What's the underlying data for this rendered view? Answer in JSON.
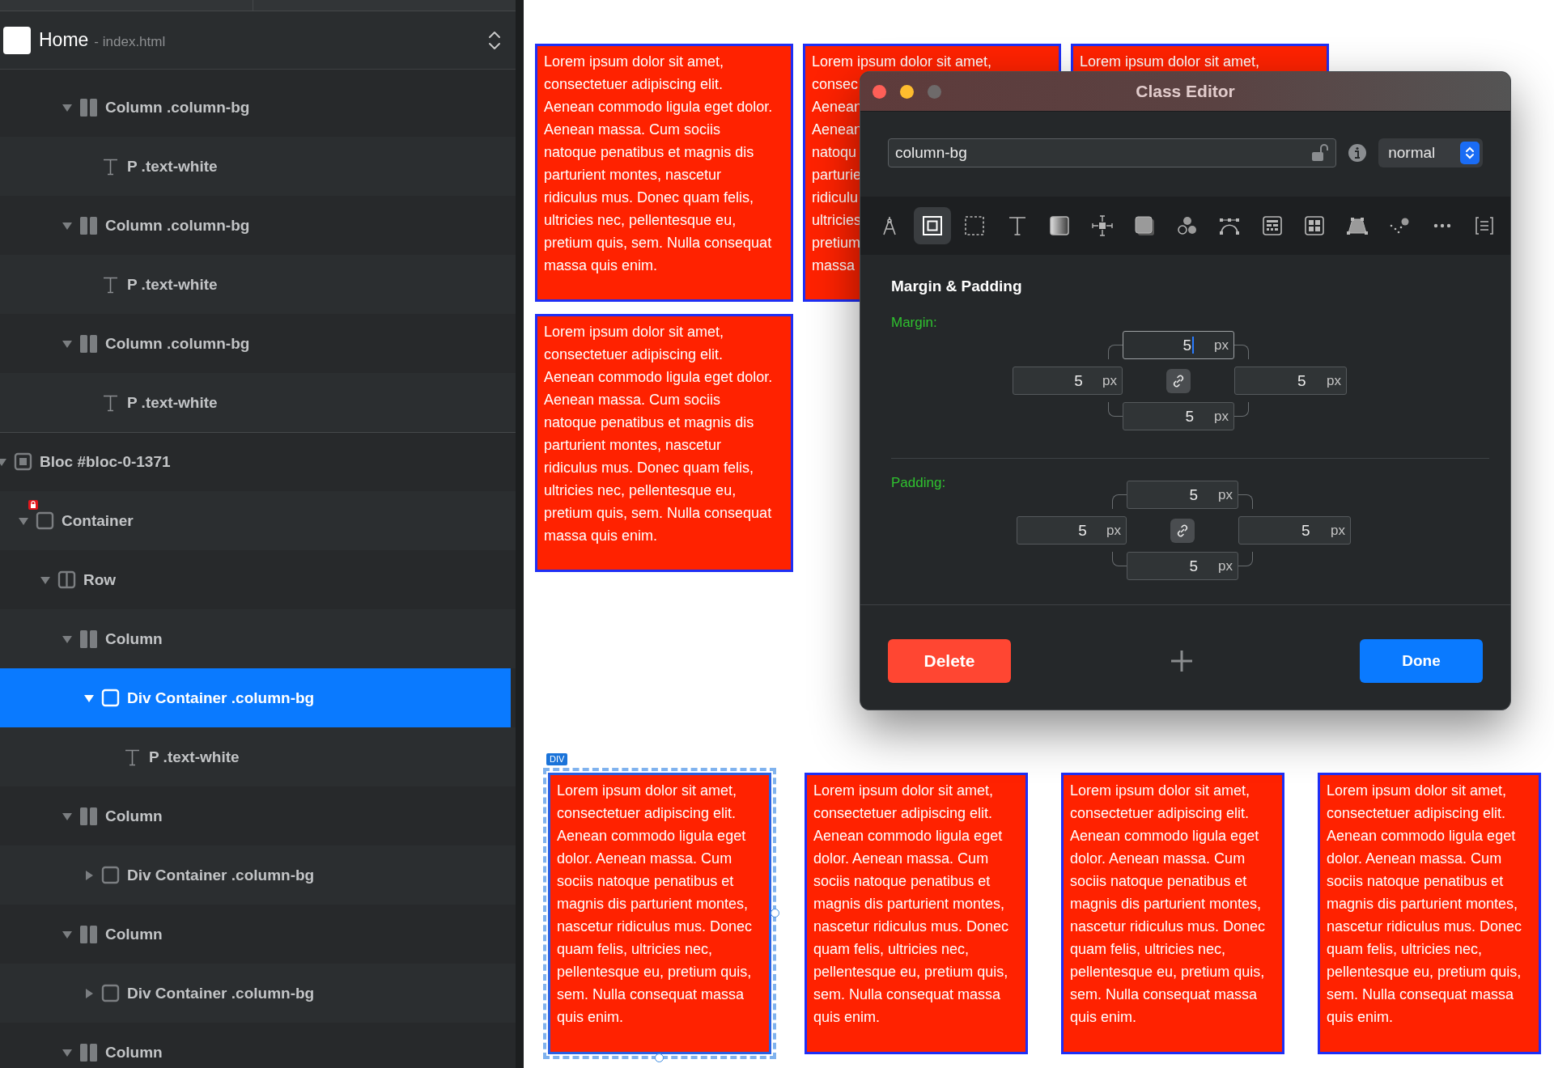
{
  "sidebar": {
    "header": {
      "title": "Home",
      "subtitle": "- index.html"
    },
    "upper_tree": [
      {
        "kind": "column",
        "label": "Column .column-bg",
        "expanded": true,
        "selected": false,
        "children": [
          {
            "kind": "text",
            "label": "P .text-white",
            "selected": false
          }
        ]
      },
      {
        "kind": "column",
        "label": "Column .column-bg",
        "expanded": true,
        "selected": false,
        "children": [
          {
            "kind": "text",
            "label": "P .text-white",
            "selected": false
          }
        ]
      },
      {
        "kind": "column",
        "label": "Column .column-bg",
        "expanded": true,
        "selected": false,
        "children": [
          {
            "kind": "text",
            "label": "P .text-white",
            "selected": false
          }
        ]
      }
    ],
    "tree": [
      {
        "kind": "bloc",
        "label": "Bloc #bloc-0-1371",
        "expanded": true,
        "selected": false,
        "children": [
          {
            "kind": "container",
            "label": "Container",
            "locked": true,
            "expanded": true,
            "selected": false,
            "children": [
              {
                "kind": "row",
                "label": "Row",
                "expanded": true,
                "selected": false,
                "children": [
                  {
                    "kind": "column",
                    "label": "Column",
                    "expanded": true,
                    "selected": false,
                    "children": [
                      {
                        "kind": "div",
                        "label": "Div Container .column-bg",
                        "expanded": true,
                        "selected": true,
                        "children": [
                          {
                            "kind": "text",
                            "label": "P .text-white",
                            "selected": false
                          }
                        ]
                      }
                    ]
                  },
                  {
                    "kind": "column",
                    "label": "Column",
                    "expanded": true,
                    "selected": false,
                    "children": [
                      {
                        "kind": "div",
                        "label": "Div Container .column-bg",
                        "expanded": false,
                        "selected": false
                      }
                    ]
                  },
                  {
                    "kind": "column",
                    "label": "Column",
                    "expanded": true,
                    "selected": false,
                    "children": [
                      {
                        "kind": "div",
                        "label": "Div Container .column-bg",
                        "expanded": false,
                        "selected": false
                      }
                    ]
                  },
                  {
                    "kind": "column",
                    "label": "Column",
                    "expanded": true,
                    "selected": false
                  }
                ]
              }
            ]
          }
        ]
      }
    ]
  },
  "canvas": {
    "top_cards": [
      {
        "lines": [
          "Lorem ipsum dolor sit amet,",
          "consectetuer adipiscing elit.",
          "Aenean commodo ligula eget dolor.",
          "Aenean massa. Cum sociis",
          "natoque penatibus et magnis dis",
          "parturient montes, nascetur",
          "ridiculus mus. Donec quam felis,",
          "ultricies nec, pellentesque eu,",
          "pretium quis, sem. Nulla consequat",
          "massa quis enim."
        ]
      },
      {
        "lines": [
          "Lorem ipsum dolor sit amet,",
          "consec",
          "Aenean",
          "Aenean",
          "natoqu",
          "parturie",
          "ridiculu",
          "ultricies",
          "pretium",
          "massa"
        ]
      },
      {
        "lines": [
          "Lorem ipsum dolor sit amet,"
        ]
      },
      {
        "lines": [
          "Lorem ipsum dolor sit amet,",
          "consectetuer adipiscing elit.",
          "Aenean commodo ligula eget dolor.",
          "Aenean massa. Cum sociis",
          "natoque penatibus et magnis dis",
          "parturient montes, nascetur",
          "ridiculus mus. Donec quam felis,",
          "ultricies nec, pellentesque eu,",
          "pretium quis, sem. Nulla consequat",
          "massa quis enim."
        ]
      }
    ],
    "bottom_cards": [
      {
        "selected": true,
        "badge": "DIV",
        "lines": [
          "Lorem ipsum dolor sit amet,",
          "consectetuer adipiscing elit.",
          "Aenean commodo ligula eget",
          "dolor. Aenean massa. Cum",
          "sociis natoque penatibus et",
          "magnis dis parturient montes,",
          "nascetur ridiculus mus. Donec",
          "quam felis, ultricies nec,",
          "pellentesque eu, pretium quis,",
          "sem. Nulla consequat massa",
          "quis enim."
        ]
      },
      {
        "selected": false,
        "lines": [
          "Lorem ipsum dolor sit amet,",
          "consectetuer adipiscing elit.",
          "Aenean commodo ligula eget",
          "dolor. Aenean massa. Cum",
          "sociis natoque penatibus et",
          "magnis dis parturient montes,",
          "nascetur ridiculus mus. Donec",
          "quam felis, ultricies nec,",
          "pellentesque eu, pretium quis,",
          "sem. Nulla consequat massa",
          "quis enim."
        ]
      },
      {
        "selected": false,
        "lines": [
          "Lorem ipsum dolor sit amet,",
          "consectetuer adipiscing elit.",
          "Aenean commodo ligula eget",
          "dolor. Aenean massa. Cum",
          "sociis natoque penatibus et",
          "magnis dis parturient montes,",
          "nascetur ridiculus mus. Donec",
          "quam felis, ultricies nec,",
          "pellentesque eu, pretium quis,",
          "sem. Nulla consequat massa",
          "quis enim."
        ]
      },
      {
        "selected": false,
        "lines": [
          "Lorem ipsum dolor sit amet,",
          "consectetuer adipiscing elit.",
          "Aenean commodo ligula eget",
          "dolor. Aenean massa. Cum",
          "sociis natoque penatibus et",
          "magnis dis parturient montes,",
          "nascetur ridiculus mus. Donec",
          "quam felis, ultricies nec,",
          "pellentesque eu, pretium quis,",
          "sem. Nulla consequat massa",
          "quis enim."
        ]
      }
    ]
  },
  "class_editor": {
    "title": "Class Editor",
    "class_field": {
      "value": "column-bg",
      "locked": false
    },
    "state": "normal",
    "tools": [
      {
        "kind": "compass",
        "selected": false
      },
      {
        "kind": "box",
        "selected": true
      },
      {
        "kind": "dashed",
        "selected": false
      },
      {
        "kind": "text",
        "selected": false
      },
      {
        "kind": "gradient",
        "selected": false
      },
      {
        "kind": "spacing",
        "selected": false
      },
      {
        "kind": "shadow",
        "selected": false
      },
      {
        "kind": "circles",
        "selected": false
      },
      {
        "kind": "bezier",
        "selected": false
      },
      {
        "kind": "table",
        "selected": false
      },
      {
        "kind": "grid",
        "selected": false
      },
      {
        "kind": "perspective",
        "selected": false
      },
      {
        "kind": "dots",
        "selected": false
      },
      {
        "kind": "more",
        "selected": false
      },
      {
        "kind": "brackets",
        "selected": false
      }
    ],
    "section_title": "Margin & Padding",
    "groups": [
      {
        "label": "Margin:",
        "fields": {
          "top": {
            "value": "5",
            "unit": "px",
            "focused": true
          },
          "left": {
            "value": "5",
            "unit": "px",
            "focused": false
          },
          "right": {
            "value": "5",
            "unit": "px",
            "focused": false
          },
          "bottom": {
            "value": "5",
            "unit": "px",
            "focused": false
          }
        }
      },
      {
        "label": "Padding:",
        "fields": {
          "top": {
            "value": "5",
            "unit": "px",
            "focused": false
          },
          "left": {
            "value": "5",
            "unit": "px",
            "focused": false
          },
          "right": {
            "value": "5",
            "unit": "px",
            "focused": false
          },
          "bottom": {
            "value": "5",
            "unit": "px",
            "focused": false
          }
        }
      }
    ],
    "buttons": [
      {
        "kind": "delete",
        "label": "Delete"
      },
      {
        "kind": "add"
      },
      {
        "kind": "done",
        "label": "Done"
      }
    ]
  }
}
